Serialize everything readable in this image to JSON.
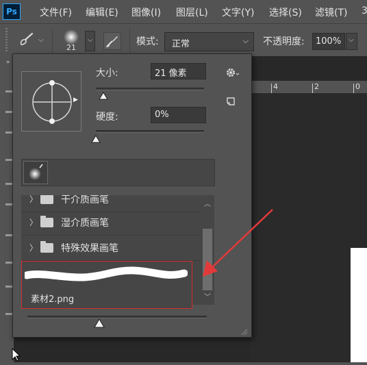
{
  "app": {
    "logo": "Ps"
  },
  "menu": [
    "文件(F)",
    "编辑(E)",
    "图像(I)",
    "图层(L)",
    "文字(Y)",
    "选择(S)",
    "滤镜(T)",
    "3"
  ],
  "options": {
    "brush_size_badge": "21",
    "mode_label": "模式:",
    "mode_value": "正常",
    "opacity_label": "不透明度:",
    "opacity_value": "100%"
  },
  "ruler": {
    "ticks": [
      "4",
      "2",
      "0"
    ]
  },
  "popup": {
    "size_label": "大小:",
    "size_value": "21 像素",
    "size_slider_fraction": 0.07,
    "hardness_label": "硬度:",
    "hardness_value": "0%",
    "hardness_slider_fraction": 0.0,
    "folders": [
      "干介质画笔",
      "湿介质画笔",
      "特殊效果画笔"
    ],
    "selected_brush": "素材2.png",
    "preview_size_fraction": 0.4
  },
  "icons": {
    "logo": "photoshop-logo",
    "brush_tool": "brush-tool-icon",
    "settings": "gear-icon",
    "new_preset": "new-preset-icon",
    "folder": "folder-icon"
  },
  "colors": {
    "highlight_border": "#d62b2b",
    "arrow": "#e23a3a",
    "logo_blue": "#31a8ff"
  }
}
